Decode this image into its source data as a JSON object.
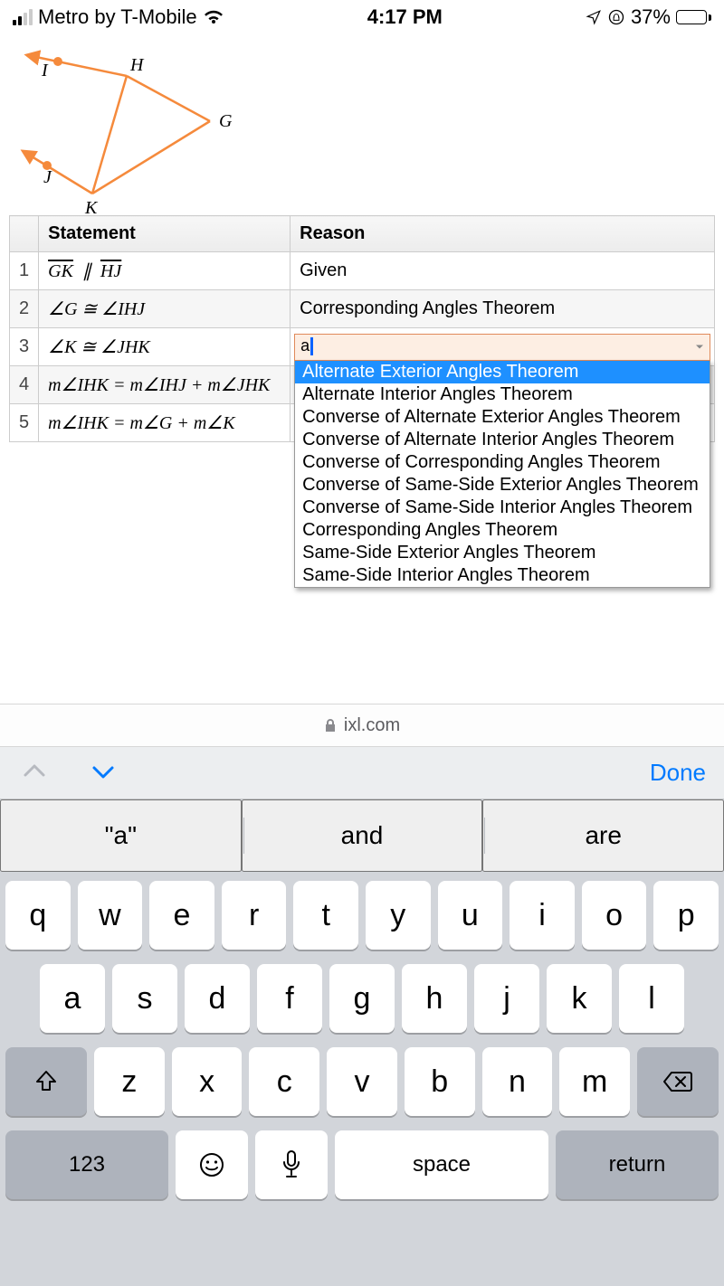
{
  "status_bar": {
    "carrier": "Metro by T-Mobile",
    "time": "4:17 PM",
    "battery_pct": "37%"
  },
  "diagram": {
    "labels": {
      "I": "I",
      "H": "H",
      "G": "G",
      "J": "J",
      "K": "K"
    }
  },
  "table": {
    "headers": {
      "statement": "Statement",
      "reason": "Reason"
    },
    "rows": [
      {
        "n": "1",
        "statement_html": "GK_par_HJ",
        "reason": "Given"
      },
      {
        "n": "2",
        "statement_html": "angG_cong_angIHJ",
        "reason": "Corresponding Angles Theorem"
      },
      {
        "n": "3",
        "statement_html": "angK_cong_angJHK",
        "reason_input": "a"
      },
      {
        "n": "4",
        "statement_html": "mIHK_eq_sum",
        "reason": ""
      },
      {
        "n": "5",
        "statement_html": "mIHK_eq_GK",
        "reason": ""
      }
    ]
  },
  "statements": {
    "GK_par_HJ": "",
    "angG_cong_angIHJ": "",
    "angK_cong_angJHK": "",
    "mIHK_eq_sum": "",
    "mIHK_eq_GK": ""
  },
  "dropdown": {
    "options": [
      "Alternate Exterior Angles Theorem",
      "Alternate Interior Angles Theorem",
      "Converse of Alternate Exterior Angles Theorem",
      "Converse of Alternate Interior Angles Theorem",
      "Converse of Corresponding Angles Theorem",
      "Converse of Same-Side Exterior Angles Theorem",
      "Converse of Same-Side Interior Angles Theorem",
      "Corresponding Angles Theorem",
      "Same-Side Exterior Angles Theorem",
      "Same-Side Interior Angles Theorem"
    ],
    "highlighted_index": 0
  },
  "url_bar": {
    "domain": "ixl.com"
  },
  "kbd_accessory": {
    "done": "Done"
  },
  "suggestions": [
    "\"a\"",
    "and",
    "are"
  ],
  "keyboard": {
    "row1": [
      "q",
      "w",
      "e",
      "r",
      "t",
      "y",
      "u",
      "i",
      "o",
      "p"
    ],
    "row2": [
      "a",
      "s",
      "d",
      "f",
      "g",
      "h",
      "j",
      "k",
      "l"
    ],
    "row3": [
      "z",
      "x",
      "c",
      "v",
      "b",
      "n",
      "m"
    ],
    "labels": {
      "numbers": "123",
      "space": "space",
      "return": "return"
    }
  }
}
